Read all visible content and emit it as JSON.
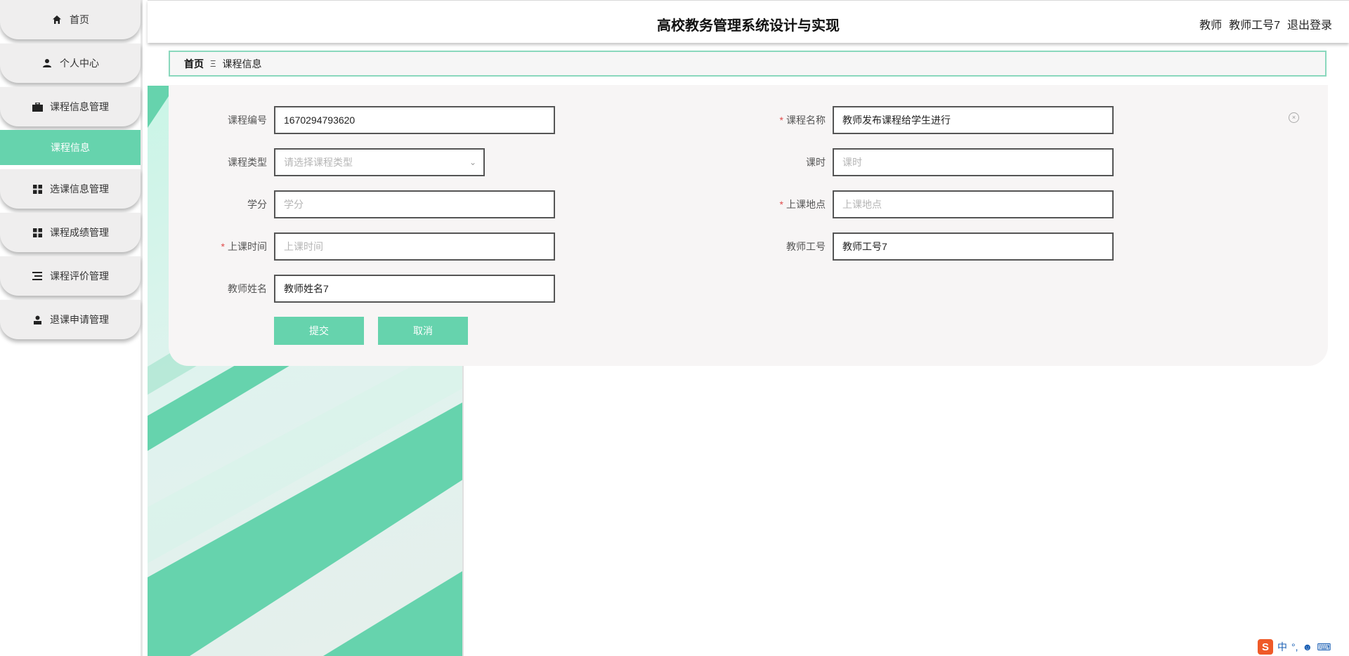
{
  "sidebar": {
    "items": [
      {
        "label": "首页",
        "icon": "home-icon"
      },
      {
        "label": "个人中心",
        "icon": "user-icon"
      },
      {
        "label": "课程信息管理",
        "icon": "briefcase-icon"
      },
      {
        "label": "课程信息",
        "icon": "",
        "active": true
      },
      {
        "label": "选课信息管理",
        "icon": "grid-icon"
      },
      {
        "label": "课程成绩管理",
        "icon": "grid-icon"
      },
      {
        "label": "课程评价管理",
        "icon": "list-icon"
      },
      {
        "label": "退课申请管理",
        "icon": "person-icon"
      }
    ]
  },
  "header": {
    "title": "高校教务管理系统设计与实现",
    "role": "教师",
    "username": "教师工号7",
    "logout": "退出登录"
  },
  "breadcrumb": {
    "home": "首页",
    "separator": "Ξ",
    "current": "课程信息"
  },
  "form": {
    "course_no": {
      "label": "课程编号",
      "value": "1670294793620"
    },
    "course_name": {
      "label": "课程名称",
      "value": "教师发布课程给学生进行",
      "required": true
    },
    "course_type": {
      "label": "课程类型",
      "placeholder": "请选择课程类型"
    },
    "hours": {
      "label": "课时",
      "placeholder": "课时"
    },
    "credits": {
      "label": "学分",
      "placeholder": "学分"
    },
    "location": {
      "label": "上课地点",
      "placeholder": "上课地点",
      "required": true
    },
    "time": {
      "label": "上课时间",
      "placeholder": "上课时间",
      "required": true
    },
    "teacher_no": {
      "label": "教师工号",
      "value": "教师工号7"
    },
    "teacher_name": {
      "label": "教师姓名",
      "value": "教师姓名7"
    },
    "submit": "提交",
    "cancel": "取消"
  },
  "ime": {
    "logo": "S",
    "mode": "中"
  },
  "colors": {
    "accent": "#66d3ad",
    "required": "#e04b4b"
  }
}
